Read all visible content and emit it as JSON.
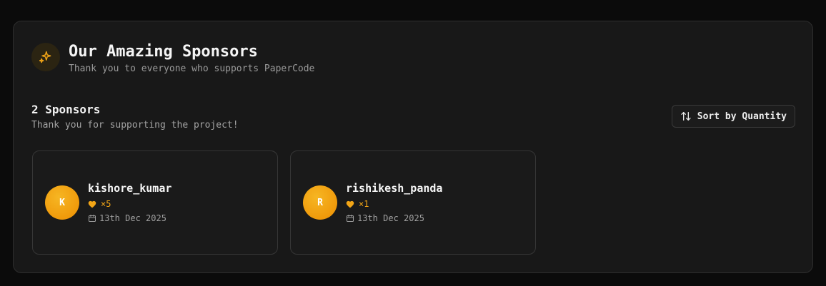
{
  "header": {
    "title": "Our Amazing Sponsors",
    "subtitle": "Thank you to everyone who supports PaperCode",
    "icon": "sparkles-icon"
  },
  "summary": {
    "count_label": "2 Sponsors",
    "thanks": "Thank you for supporting the project!"
  },
  "sort": {
    "label": "Sort by Quantity",
    "icon": "sort-arrows-icon"
  },
  "colors": {
    "accent": "#f2a516",
    "avatar": "#f09a0b",
    "background": "#181818"
  },
  "sponsors": [
    {
      "initial": "K",
      "name": "kishore_kumar",
      "quantity": "×5",
      "date": "13th Dec 2025"
    },
    {
      "initial": "R",
      "name": "rishikesh_panda",
      "quantity": "×1",
      "date": "13th Dec 2025"
    }
  ]
}
